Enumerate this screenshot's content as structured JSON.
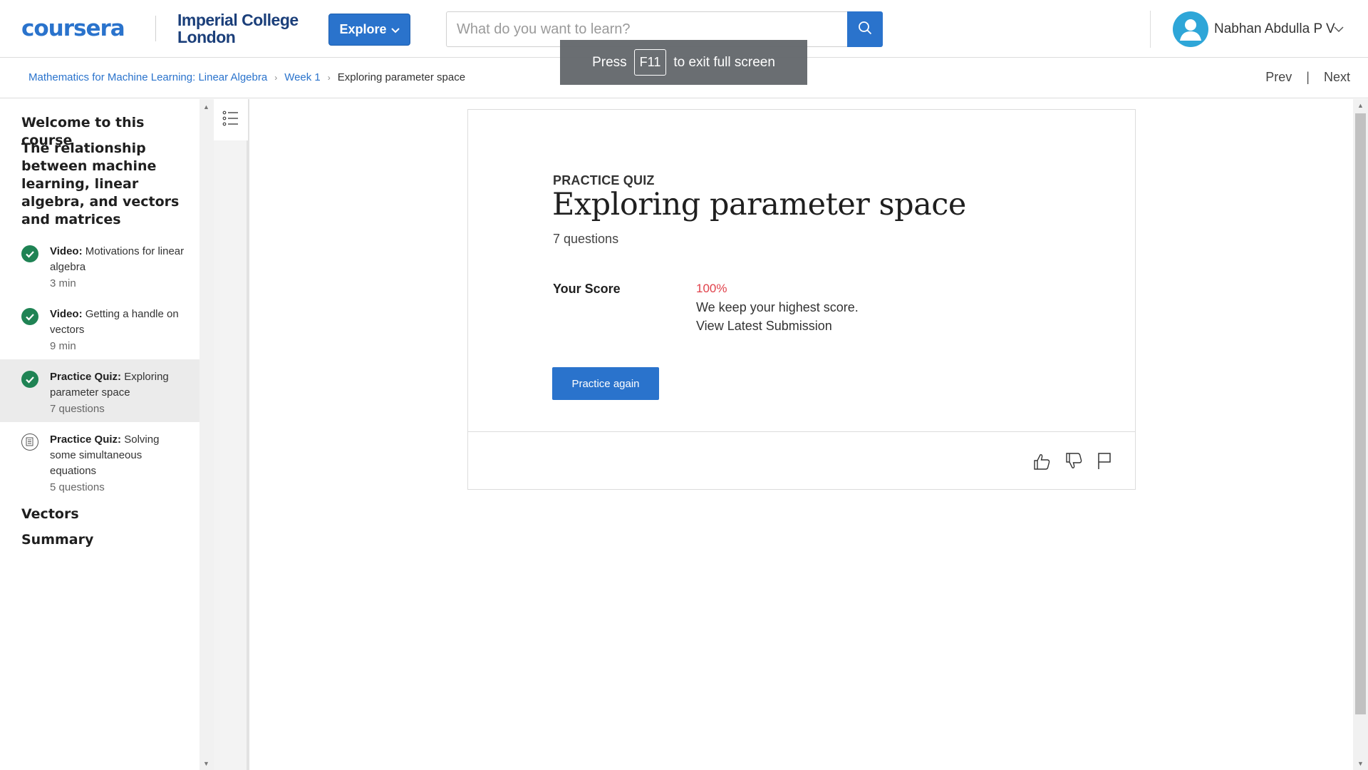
{
  "header": {
    "logo_text": "coursera",
    "partner_line1": "Imperial College",
    "partner_line2": "London",
    "explore_label": "Explore",
    "search_placeholder": "What do you want to learn?",
    "user_name": "Nabhan Abdulla P V"
  },
  "toast": {
    "prefix": "Press",
    "key": "F11",
    "suffix": "to exit full screen"
  },
  "breadcrumb": {
    "course": "Mathematics for Machine Learning: Linear Algebra",
    "week": "Week 1",
    "current": "Exploring parameter space"
  },
  "nav": {
    "prev": "Prev",
    "separator": "|",
    "next": "Next"
  },
  "sidebar": {
    "sections": [
      {
        "title": "Welcome to this course"
      },
      {
        "title": "The relationship between machine learning, linear algebra, and vectors and matrices"
      },
      {
        "title": "Vectors"
      },
      {
        "title": "Summary"
      }
    ],
    "items": [
      {
        "type": "Video:",
        "name": "Motivations for linear algebra",
        "meta": "3 min",
        "status": "completed"
      },
      {
        "type": "Video:",
        "name": "Getting a handle on vectors",
        "meta": "9 min",
        "status": "completed"
      },
      {
        "type": "Practice Quiz:",
        "name": "Exploring parameter space",
        "meta": "7 questions",
        "status": "completed"
      },
      {
        "type": "Practice Quiz:",
        "name": "Solving some simultaneous equations",
        "meta": "5 questions",
        "status": "not-started"
      }
    ]
  },
  "quiz": {
    "kicker": "PRACTICE QUIZ",
    "title": "Exploring parameter space",
    "question_count": "7 questions",
    "score_label": "Your Score",
    "score_value": "100%",
    "score_note": "We keep your highest score.",
    "view_latest": "View Latest Submission",
    "practice_again": "Practice again"
  },
  "colors": {
    "brand_blue": "#2a73cc",
    "success_green": "#1f8354",
    "score_red": "#e0414a"
  }
}
